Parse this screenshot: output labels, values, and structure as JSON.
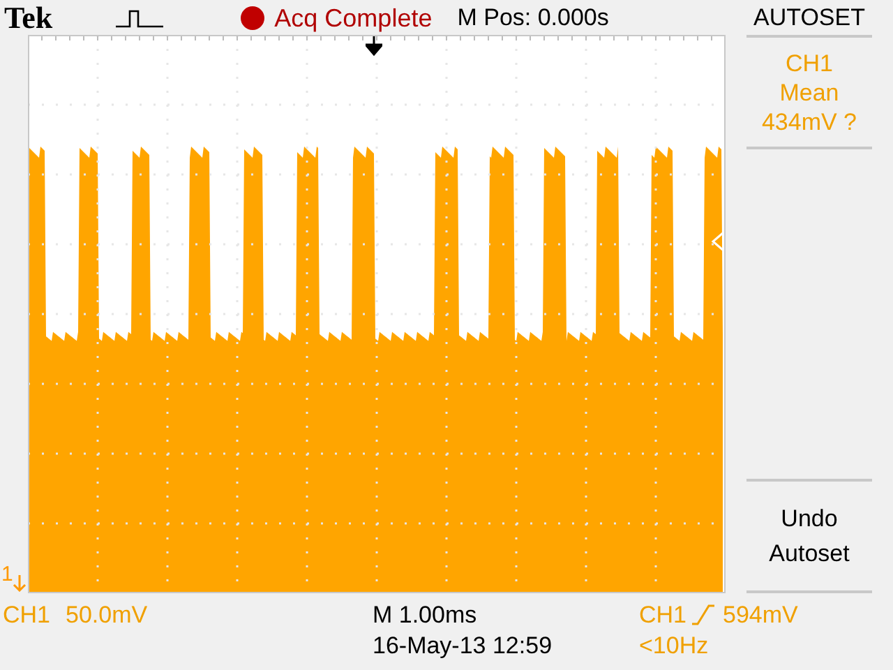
{
  "header": {
    "logo": "Tek",
    "acquisition": "Acq Complete",
    "position": "M Pos: 0.000s"
  },
  "side_menu": {
    "title": "AUTOSET",
    "items": [
      {
        "kind": "readout",
        "lines": [
          "CH1",
          "Mean",
          "434mV ?"
        ]
      },
      {
        "kind": "button",
        "lines": [
          "Undo",
          "Autoset"
        ]
      }
    ]
  },
  "channel_marker": "1",
  "footer": {
    "channel": "CH1",
    "scale": "50.0mV",
    "timebase": "M 1.00ms",
    "datetime": "16-May-13 12:59",
    "trigger_source": "CH1",
    "trigger_rising": true,
    "trigger_level": "594mV",
    "frequency": "<10Hz"
  }
}
